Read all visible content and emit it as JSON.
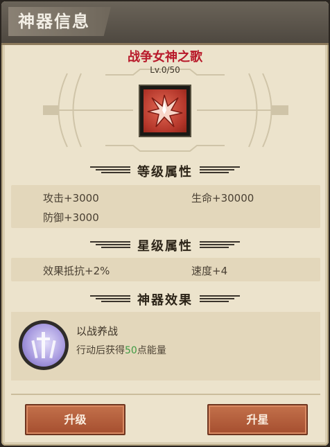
{
  "header": {
    "title": "神器信息"
  },
  "artifact": {
    "name": "战争女神之歌",
    "level": "Lv.0/50",
    "icon": "red-flame-crystal-icon"
  },
  "sections": {
    "level_attrs": "等级属性",
    "star_attrs": "星级属性",
    "effect": "神器效果"
  },
  "level_attrs": [
    {
      "label": "攻击+3000"
    },
    {
      "label": "生命+30000"
    },
    {
      "label": "防御+3000"
    }
  ],
  "star_attrs": [
    {
      "label": "效果抵抗+2%"
    },
    {
      "label": "速度+4"
    }
  ],
  "effect": {
    "icon": "purple-swords-icon",
    "name": "以战养战",
    "desc_prefix": "行动后获得",
    "desc_value": "50",
    "desc_suffix": "点能量",
    "highlight_color": "#3d9a43"
  },
  "buttons": {
    "upgrade": "升级",
    "star_up": "升星"
  },
  "colors": {
    "title_red": "#b8192a",
    "button": "#b55e3b",
    "panel": "#ece3cc"
  }
}
